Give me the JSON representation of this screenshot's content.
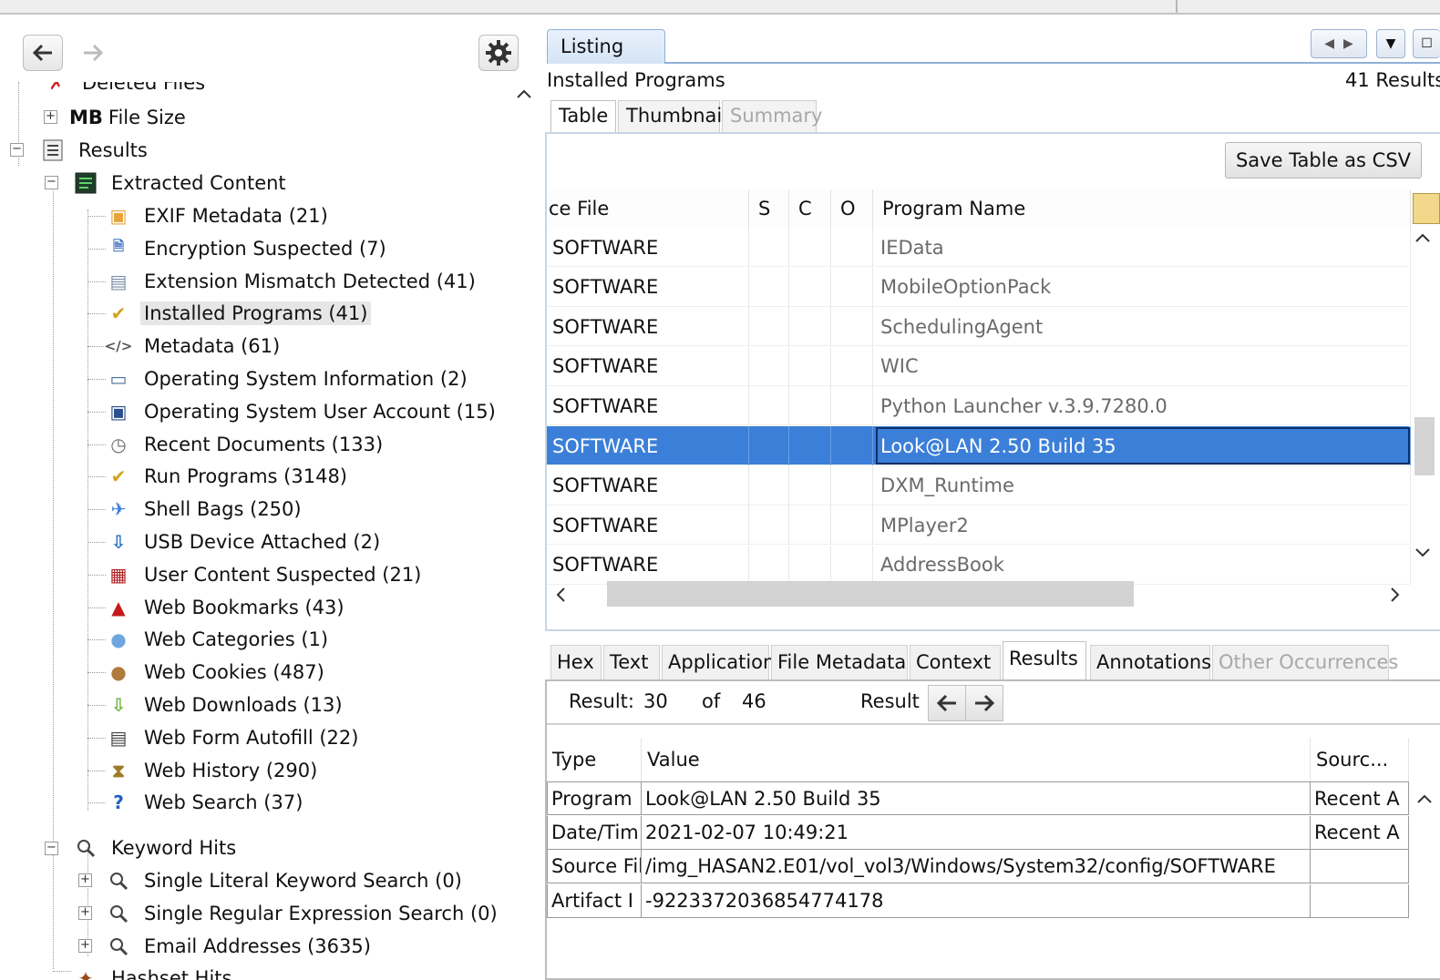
{
  "left_panel": {
    "back_label": "Back",
    "forward_label": "Forward",
    "tree": {
      "deleted_files": "Deleted Files",
      "file_size": "File Size",
      "file_size_badge": "MB",
      "results": "Results",
      "extracted_content": "Extracted Content",
      "items": [
        {
          "label": "EXIF Metadata (21)",
          "icon": "camera-folder-icon"
        },
        {
          "label": "Encryption Suspected (7)",
          "icon": "encrypted-doc-icon"
        },
        {
          "label": "Extension Mismatch Detected (41)",
          "icon": "mismatch-doc-icon"
        },
        {
          "label": "Installed Programs (41)",
          "icon": "installer-icon"
        },
        {
          "label": "Metadata (61)",
          "icon": "code-tag-icon"
        },
        {
          "label": "Operating System Information (2)",
          "icon": "computer-icon"
        },
        {
          "label": "Operating System User Account (15)",
          "icon": "user-computer-icon"
        },
        {
          "label": "Recent Documents (133)",
          "icon": "recent-doc-icon"
        },
        {
          "label": "Run Programs (3148)",
          "icon": "run-program-icon"
        },
        {
          "label": "Shell Bags (250)",
          "icon": "shell-bags-icon"
        },
        {
          "label": "USB Device Attached (2)",
          "icon": "usb-icon"
        },
        {
          "label": "User Content Suspected (21)",
          "icon": "user-content-icon"
        },
        {
          "label": "Web Bookmarks (43)",
          "icon": "bookmark-icon"
        },
        {
          "label": "Web Categories (1)",
          "icon": "globe-icon"
        },
        {
          "label": "Web Cookies (487)",
          "icon": "cookie-icon"
        },
        {
          "label": "Web Downloads (13)",
          "icon": "download-icon"
        },
        {
          "label": "Web Form Autofill (22)",
          "icon": "form-icon"
        },
        {
          "label": "Web History (290)",
          "icon": "hourglass-icon"
        },
        {
          "label": "Web Search (37)",
          "icon": "web-search-icon"
        }
      ],
      "keyword_hits": "Keyword Hits",
      "keyword_items": [
        "Single Literal Keyword Search (0)",
        "Single Regular Expression Search (0)",
        "Email Addresses (3635)"
      ],
      "hashset_hits": "Hashset Hits"
    }
  },
  "right_panel": {
    "listing_tab": "Listing",
    "title": "Installed Programs",
    "result_count": "41  Results",
    "view_tabs": [
      "Table",
      "Thumbnail",
      "Summary"
    ],
    "save_csv": "Save Table as CSV",
    "columns": [
      "ce File",
      "S",
      "C",
      "O",
      "Program Name"
    ],
    "rows": [
      {
        "source": "SOFTWARE",
        "program": "IEData"
      },
      {
        "source": "SOFTWARE",
        "program": "MobileOptionPack"
      },
      {
        "source": "SOFTWARE",
        "program": "SchedulingAgent"
      },
      {
        "source": "SOFTWARE",
        "program": "WIC"
      },
      {
        "source": "SOFTWARE",
        "program": "Python Launcher v.3.9.7280.0"
      },
      {
        "source": "SOFTWARE",
        "program": "Look@LAN 2.50 Build 35"
      },
      {
        "source": "SOFTWARE",
        "program": "DXM_Runtime"
      },
      {
        "source": "SOFTWARE",
        "program": "MPlayer2"
      },
      {
        "source": "SOFTWARE",
        "program": "AddressBook"
      }
    ],
    "selected_row": 5,
    "bottom_tabs": [
      "Hex",
      "Text",
      "Application",
      "File Metadata",
      "Context",
      "Results",
      "Annotations",
      "Other Occurrences"
    ],
    "result_nav": {
      "result_label": "Result:",
      "current": "30",
      "of_label": "of",
      "total": "46",
      "nav_label": "Result"
    },
    "detail_columns": [
      "Type",
      "Value",
      "Sourc..."
    ],
    "detail_rows": [
      {
        "type": "Program",
        "value": "Look@LAN 2.50 Build 35",
        "source": "Recent A"
      },
      {
        "type": "Date/Tim",
        "value": "2021-02-07 10:49:21",
        "source": "Recent A"
      },
      {
        "type": "Source Fil",
        "value": "/img_HASAN2.E01/vol_vol3/Windows/System32/config/SOFTWARE",
        "source": ""
      },
      {
        "type": "Artifact I",
        "value": "-9223372036854774178",
        "source": ""
      }
    ]
  },
  "colors": {
    "selection": "#3b7fd8",
    "tab_accent": "#8fb0d8"
  }
}
